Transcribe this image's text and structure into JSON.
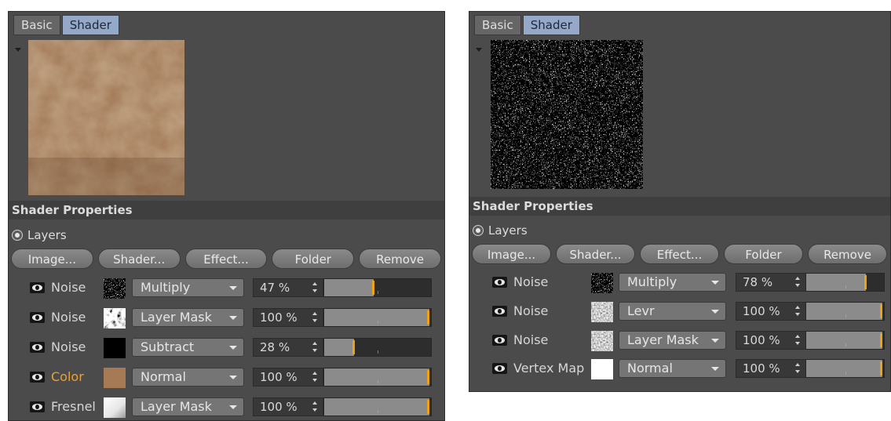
{
  "left_panel": {
    "tabs": [
      {
        "label": "Basic",
        "active": false
      },
      {
        "label": "Shader",
        "active": true
      }
    ],
    "preview": {
      "type": "brown-noise-texture",
      "base_color": "#8a6040"
    },
    "section_title": "Shader Properties",
    "layers_label": "Layers",
    "buttons": [
      "Image...",
      "Shader...",
      "Effect...",
      "Folder",
      "Remove"
    ],
    "layers": [
      {
        "name": "Noise",
        "name_color": "#d6d6d6",
        "thumb": "noise-fine",
        "mode": "Multiply",
        "value": "47 %",
        "level": 0.47
      },
      {
        "name": "Noise",
        "name_color": "#d6d6d6",
        "thumb": "noise-veins",
        "mode": "Layer Mask",
        "value": "100 %",
        "level": 1.0
      },
      {
        "name": "Noise",
        "name_color": "#d6d6d6",
        "thumb": "noise-dark",
        "mode": "Subtract",
        "value": "28 %",
        "level": 0.28
      },
      {
        "name": "Color",
        "name_color": "#e8a13a",
        "thumb": "color-swatch",
        "swatch": "#a57a55",
        "mode": "Normal",
        "value": "100 %",
        "level": 1.0
      },
      {
        "name": "Fresnel",
        "name_color": "#d6d6d6",
        "thumb": "fresnel-gradient",
        "mode": "Layer Mask",
        "value": "100 %",
        "level": 1.0
      }
    ]
  },
  "right_panel": {
    "tabs": [
      {
        "label": "Basic",
        "active": false
      },
      {
        "label": "Shader",
        "active": true
      }
    ],
    "preview": {
      "type": "black-white-noise-texture"
    },
    "section_title": "Shader Properties",
    "layers_label": "Layers",
    "buttons": [
      "Image...",
      "Shader...",
      "Effect...",
      "Folder",
      "Remove"
    ],
    "layers": [
      {
        "name": "Noise",
        "thumb": "noise-fine",
        "mode": "Multiply",
        "value": "78 %",
        "level": 0.78
      },
      {
        "name": "Noise",
        "thumb": "noise-grey",
        "mode": "Levr",
        "value": "100 %",
        "level": 1.0
      },
      {
        "name": "Noise",
        "thumb": "noise-grey",
        "mode": "Layer Mask",
        "value": "100 %",
        "level": 1.0
      },
      {
        "name": "Vertex Map",
        "thumb": "white-swatch",
        "swatch": "#ffffff",
        "mode": "Normal",
        "value": "100 %",
        "level": 1.0
      }
    ]
  },
  "colors": {
    "panel_bg": "#4b4b4b",
    "active_tab": "#93a9c7",
    "slider_handle": "#f0a312",
    "accent_label": "#e8a13a"
  }
}
